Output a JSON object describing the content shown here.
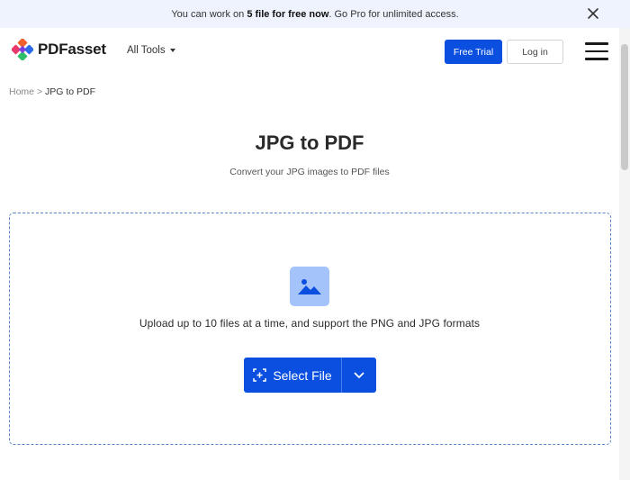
{
  "banner": {
    "text_before": "You can work on ",
    "text_bold": "5 file for free now",
    "text_after": ". Go Pro for unlimited access."
  },
  "header": {
    "logo_text": "PDFasset",
    "all_tools_label": "All Tools",
    "free_trial_label": "Free Trial",
    "login_label": "Log in"
  },
  "breadcrumb": {
    "home": "Home",
    "separator": ">",
    "current": "JPG to PDF"
  },
  "main": {
    "title": "JPG to PDF",
    "subtitle": "Convert your JPG images to PDF files",
    "upload_hint": "Upload up to 10 files at a time, and support the PNG and JPG formats",
    "select_file_label": "Select File"
  },
  "icons": {
    "close": "close-icon",
    "menu": "hamburger-menu-icon",
    "image": "image-icon",
    "add_file": "add-file-icon",
    "chevron": "chevron-down-icon"
  },
  "colors": {
    "brand_blue": "#0a4fe0",
    "banner_bg": "#eef3fd",
    "image_icon_bg": "#a5c3fb",
    "dropzone_border": "#5a86c8"
  }
}
